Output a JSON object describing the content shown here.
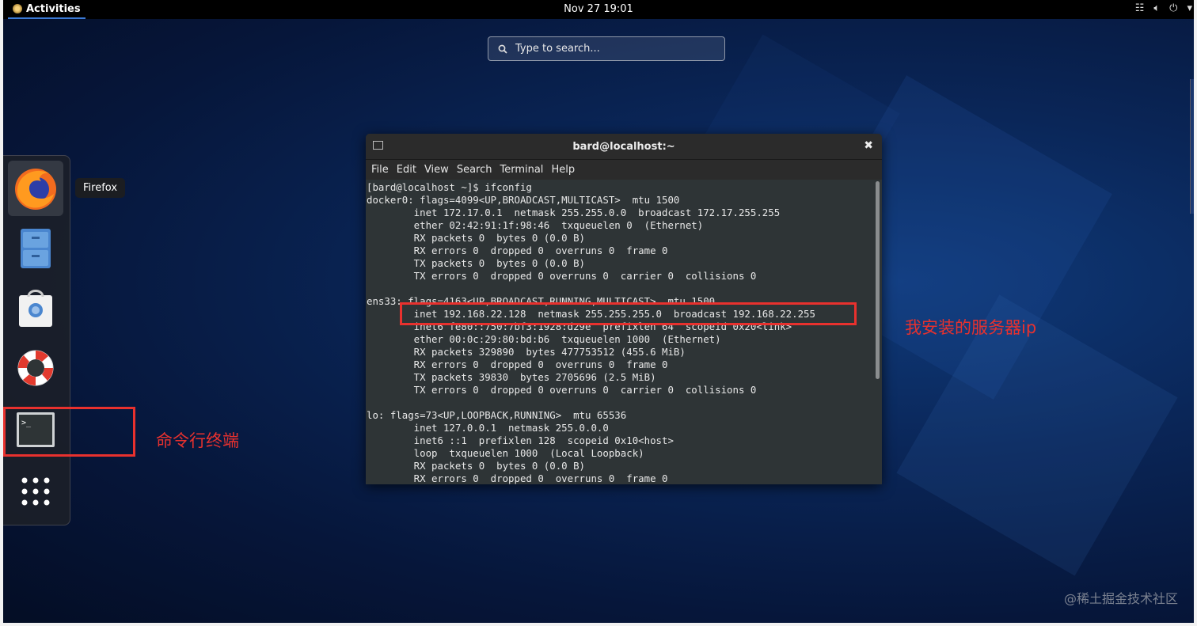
{
  "topbar": {
    "activities_label": "Activities",
    "clock": "Nov 27  19:01",
    "indicators": [
      "network-icon",
      "volume-icon",
      "power-icon",
      "chevron-down-icon"
    ]
  },
  "search": {
    "placeholder": "Type to search..."
  },
  "dash": {
    "items": [
      {
        "name": "Firefox",
        "icon": "firefox-icon"
      },
      {
        "name": "Files",
        "icon": "file-cabinet-icon"
      },
      {
        "name": "Software",
        "icon": "shopping-bag-icon"
      },
      {
        "name": "Help",
        "icon": "lifebuoy-icon"
      },
      {
        "name": "Terminal",
        "icon": "terminal-icon"
      },
      {
        "name": "Show Applications",
        "icon": "grid-icon"
      }
    ],
    "tooltip": "Firefox"
  },
  "terminal": {
    "title": "bard@localhost:~",
    "menu": [
      "File",
      "Edit",
      "View",
      "Search",
      "Terminal",
      "Help"
    ],
    "output": "[bard@localhost ~]$ ifconfig\ndocker0: flags=4099<UP,BROADCAST,MULTICAST>  mtu 1500\n        inet 172.17.0.1  netmask 255.255.0.0  broadcast 172.17.255.255\n        ether 02:42:91:1f:98:46  txqueuelen 0  (Ethernet)\n        RX packets 0  bytes 0 (0.0 B)\n        RX errors 0  dropped 0  overruns 0  frame 0\n        TX packets 0  bytes 0 (0.0 B)\n        TX errors 0  dropped 0 overruns 0  carrier 0  collisions 0\n\nens33: flags=4163<UP,BROADCAST,RUNNING,MULTICAST>  mtu 1500\n        inet 192.168.22.128  netmask 255.255.255.0  broadcast 192.168.22.255\n        inet6 fe80::750:7bf3:1928:d29e  prefixlen 64  scopeid 0x20<link>\n        ether 00:0c:29:80:bd:b6  txqueuelen 1000  (Ethernet)\n        RX packets 329890  bytes 477753512 (455.6 MiB)\n        RX errors 0  dropped 0  overruns 0  frame 0\n        TX packets 39830  bytes 2705696 (2.5 MiB)\n        TX errors 0  dropped 0 overruns 0  carrier 0  collisions 0\n\nlo: flags=73<UP,LOOPBACK,RUNNING>  mtu 65536\n        inet 127.0.0.1  netmask 255.0.0.0\n        inet6 ::1  prefixlen 128  scopeid 0x10<host>\n        loop  txqueuelen 1000  (Local Loopback)\n        RX packets 0  bytes 0 (0.0 B)\n        RX errors 0  dropped 0  overruns 0  frame 0"
  },
  "annotations": {
    "server_ip_note": "我安装的服务器ip",
    "terminal_note": "命令行终端",
    "color": "#e8312e"
  },
  "watermark": "@稀土掘金技术社区"
}
